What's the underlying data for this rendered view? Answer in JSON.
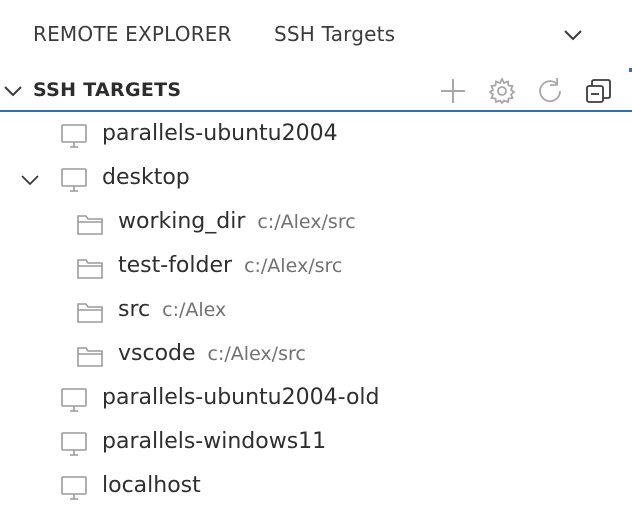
{
  "panel": {
    "title": "REMOTE EXPLORER",
    "view_selector": "SSH Targets",
    "view_selector_icon": "chevron-down-icon"
  },
  "section": {
    "title": "SSH TARGETS",
    "expanded": true,
    "actions": [
      {
        "name": "add-new-target-button",
        "icon": "plus-icon"
      },
      {
        "name": "configure-button",
        "icon": "gear-icon"
      },
      {
        "name": "refresh-button",
        "icon": "refresh-icon"
      },
      {
        "name": "collapse-all-button",
        "icon": "collapse-all-icon"
      }
    ]
  },
  "targets": [
    {
      "label": "parallels-ubuntu2004",
      "icon": "monitor-icon",
      "expanded": false,
      "children": []
    },
    {
      "label": "desktop",
      "icon": "monitor-icon",
      "expanded": true,
      "children": [
        {
          "label": "working_dir",
          "path": "c:/Alex/src",
          "icon": "folder-icon"
        },
        {
          "label": "test-folder",
          "path": "c:/Alex/src",
          "icon": "folder-icon"
        },
        {
          "label": "src",
          "path": "c:/Alex",
          "icon": "folder-icon"
        },
        {
          "label": "vscode",
          "path": "c:/Alex/src",
          "icon": "folder-icon"
        }
      ]
    },
    {
      "label": "parallels-ubuntu2004-old",
      "icon": "monitor-icon",
      "expanded": false,
      "children": []
    },
    {
      "label": "parallels-windows11",
      "icon": "monitor-icon",
      "expanded": false,
      "children": []
    },
    {
      "label": "localhost",
      "icon": "monitor-icon",
      "expanded": false,
      "children": []
    }
  ],
  "colors": {
    "accent_rule": "#3b6ea5",
    "icon_gray": "#9a9a9a",
    "description": "#717171"
  }
}
